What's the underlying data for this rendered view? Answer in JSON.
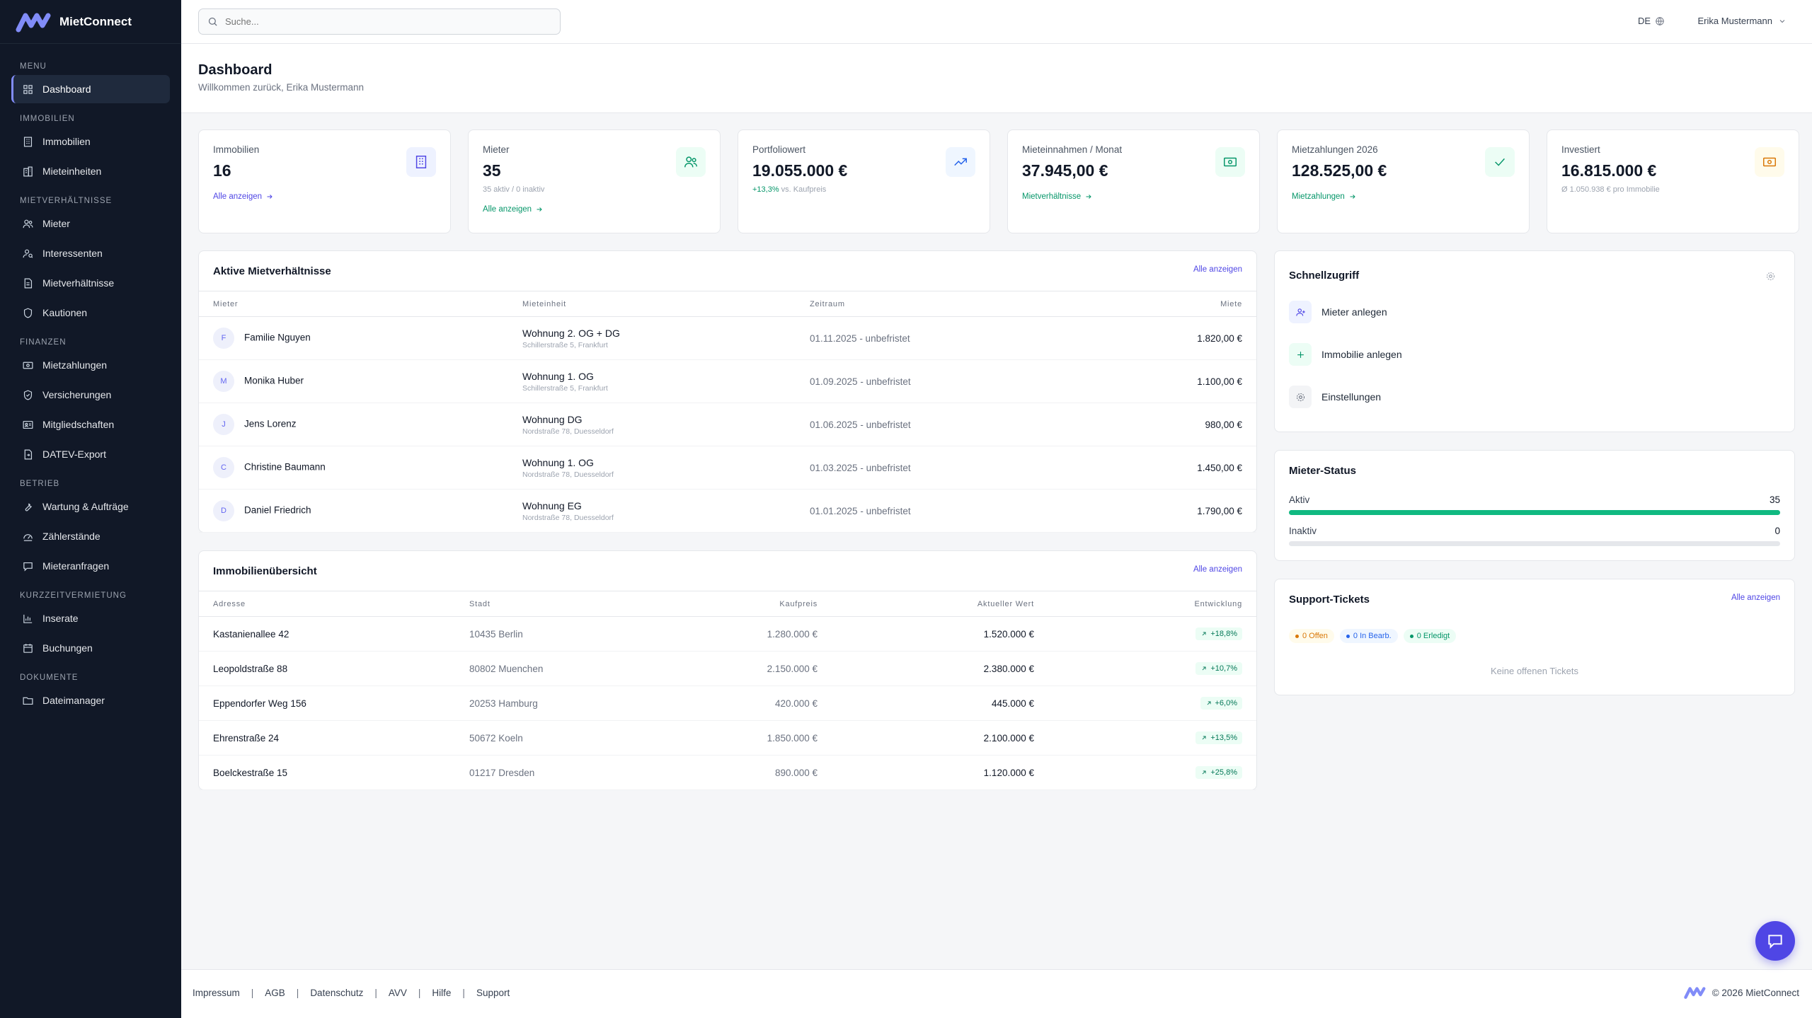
{
  "app": {
    "name": "MietConnect"
  },
  "sidebar": {
    "sections": [
      {
        "title": "Menu",
        "items": [
          {
            "label": "Dashboard",
            "icon": "grid-icon",
            "active": true
          }
        ]
      },
      {
        "title": "Immobilien",
        "items": [
          {
            "label": "Immobilien",
            "icon": "building-icon"
          },
          {
            "label": "Mieteinheiten",
            "icon": "apartment-icon"
          }
        ]
      },
      {
        "title": "Mietverhältnisse",
        "items": [
          {
            "label": "Mieter",
            "icon": "users-icon"
          },
          {
            "label": "Interessenten",
            "icon": "user-search-icon"
          },
          {
            "label": "Mietverhältnisse",
            "icon": "contract-icon"
          },
          {
            "label": "Kautionen",
            "icon": "shield-icon"
          }
        ]
      },
      {
        "title": "Finanzen",
        "items": [
          {
            "label": "Mietzahlungen",
            "icon": "banknote-icon"
          },
          {
            "label": "Versicherungen",
            "icon": "shield-check-icon"
          },
          {
            "label": "Mitgliedschaften",
            "icon": "membership-card-icon"
          },
          {
            "label": "DATEV-Export",
            "icon": "file-export-icon"
          }
        ]
      },
      {
        "title": "Betrieb",
        "items": [
          {
            "label": "Wartung & Aufträge",
            "icon": "wrench-icon"
          },
          {
            "label": "Zählerstände",
            "icon": "gauge-icon"
          },
          {
            "label": "Mieteranfragen",
            "icon": "message-icon"
          }
        ]
      },
      {
        "title": "Kurzzeitvermietung",
        "items": [
          {
            "label": "Inserate",
            "icon": "listing-chart-icon"
          },
          {
            "label": "Buchungen",
            "icon": "calendar-icon"
          }
        ]
      },
      {
        "title": "Dokumente",
        "items": [
          {
            "label": "Dateimanager",
            "icon": "folder-icon"
          }
        ]
      }
    ]
  },
  "topbar": {
    "search_placeholder": "Suche...",
    "language": "DE",
    "user_name": "Erika Mustermann"
  },
  "header": {
    "title": "Dashboard",
    "subtitle": "Willkommen zurück, Erika Mustermann"
  },
  "kpis": [
    {
      "label": "Immobilien",
      "value": "16",
      "sub": "",
      "link": "Alle anzeigen",
      "icon": "building-icon",
      "accent": "#4f46e5",
      "bg": "#eef2ff"
    },
    {
      "label": "Mieter",
      "value": "35",
      "sub": "35 aktiv / 0 inaktiv",
      "link": "Alle anzeigen",
      "icon": "users-icon",
      "accent": "#059669",
      "bg": "#ecfdf5"
    },
    {
      "label": "Portfoliowert",
      "value": "19.055.000 €",
      "sub_highlight": "+13,3%",
      "sub_rest": " vs. Kaufpreis",
      "link": "",
      "icon": "trending-up-icon",
      "accent": "#2563eb",
      "bg": "#eff6ff"
    },
    {
      "label": "Mieteinnahmen / Monat",
      "value": "37.945,00 €",
      "sub": "",
      "link": "Mietverhältnisse",
      "icon": "banknote-icon",
      "accent": "#059669",
      "bg": "#ecfdf5"
    },
    {
      "label": "Mietzahlungen 2026",
      "value": "128.525,00 €",
      "sub": "",
      "link": "Mietzahlungen",
      "icon": "check-icon",
      "accent": "#059669",
      "bg": "#ecfdf5"
    },
    {
      "label": "Investiert",
      "value": "16.815.000 €",
      "sub": "Ø 1.050.938 € pro Immobilie",
      "link": "",
      "icon": "banknote-icon",
      "accent": "#d97706",
      "bg": "#fffbeb"
    }
  ],
  "tenancies": {
    "title": "Aktive Mietverhältnisse",
    "link": "Alle anzeigen",
    "columns": [
      "Mieter",
      "Mieteinheit",
      "Zeitraum",
      "Miete"
    ],
    "rows": [
      {
        "initial": "F",
        "name": "Familie Nguyen",
        "unit": "Wohnung 2. OG + DG",
        "address": "Schillerstraße 5, Frankfurt",
        "period": "01.11.2025 - unbefristet",
        "rent": "1.820,00 €"
      },
      {
        "initial": "M",
        "name": "Monika Huber",
        "unit": "Wohnung 1. OG",
        "address": "Schillerstraße 5, Frankfurt",
        "period": "01.09.2025 - unbefristet",
        "rent": "1.100,00 €"
      },
      {
        "initial": "J",
        "name": "Jens Lorenz",
        "unit": "Wohnung DG",
        "address": "Nordstraße 78, Duesseldorf",
        "period": "01.06.2025 - unbefristet",
        "rent": "980,00 €"
      },
      {
        "initial": "C",
        "name": "Christine Baumann",
        "unit": "Wohnung 1. OG",
        "address": "Nordstraße 78, Duesseldorf",
        "period": "01.03.2025 - unbefristet",
        "rent": "1.450,00 €"
      },
      {
        "initial": "D",
        "name": "Daniel Friedrich",
        "unit": "Wohnung EG",
        "address": "Nordstraße 78, Duesseldorf",
        "period": "01.01.2025 - unbefristet",
        "rent": "1.790,00 €"
      }
    ]
  },
  "properties": {
    "title": "Immobilienübersicht",
    "link": "Alle anzeigen",
    "columns": [
      "Adresse",
      "Stadt",
      "Kaufpreis",
      "Aktueller Wert",
      "Entwicklung"
    ],
    "rows": [
      {
        "address": "Kastanienallee 42",
        "city": "10435 Berlin",
        "price": "1.280.000 €",
        "value": "1.520.000 €",
        "change": "+18,8%"
      },
      {
        "address": "Leopoldstraße 88",
        "city": "80802 Muenchen",
        "price": "2.150.000 €",
        "value": "2.380.000 €",
        "change": "+10,7%"
      },
      {
        "address": "Eppendorfer Weg 156",
        "city": "20253 Hamburg",
        "price": "420.000 €",
        "value": "445.000 €",
        "change": "+6,0%"
      },
      {
        "address": "Ehrenstraße 24",
        "city": "50672 Koeln",
        "price": "1.850.000 €",
        "value": "2.100.000 €",
        "change": "+13,5%"
      },
      {
        "address": "Boelckestraße 15",
        "city": "01217 Dresden",
        "price": "890.000 €",
        "value": "1.120.000 €",
        "change": "+25,8%"
      }
    ]
  },
  "quick_access": {
    "title": "Schnellzugriff",
    "items": [
      {
        "label": "Mieter anlegen",
        "icon": "user-plus-icon"
      },
      {
        "label": "Immobilie anlegen",
        "icon": "plus-icon"
      },
      {
        "label": "Einstellungen",
        "icon": "settings-icon"
      }
    ]
  },
  "tenant_status": {
    "title": "Mieter-Status",
    "active_label": "Aktiv",
    "active_value": "35",
    "active_fraction": 1.0,
    "inactive_label": "Inaktiv",
    "inactive_value": "0",
    "inactive_fraction": 0.0
  },
  "support": {
    "title": "Support-Tickets",
    "link": "Alle anzeigen",
    "badges": [
      {
        "label": "0 Offen",
        "color": "#d97706",
        "bg": "#fffbeb"
      },
      {
        "label": "0 In Bearb.",
        "color": "#2563eb",
        "bg": "#eff6ff"
      },
      {
        "label": "0 Erledigt",
        "color": "#059669",
        "bg": "#ecfdf5"
      }
    ],
    "empty": "Keine offenen Tickets"
  },
  "footer": {
    "links": [
      "Impressum",
      "AGB",
      "Datenschutz",
      "AVV",
      "Hilfe",
      "Support"
    ],
    "separator": "|",
    "copyright": "© 2026 MietConnect"
  }
}
